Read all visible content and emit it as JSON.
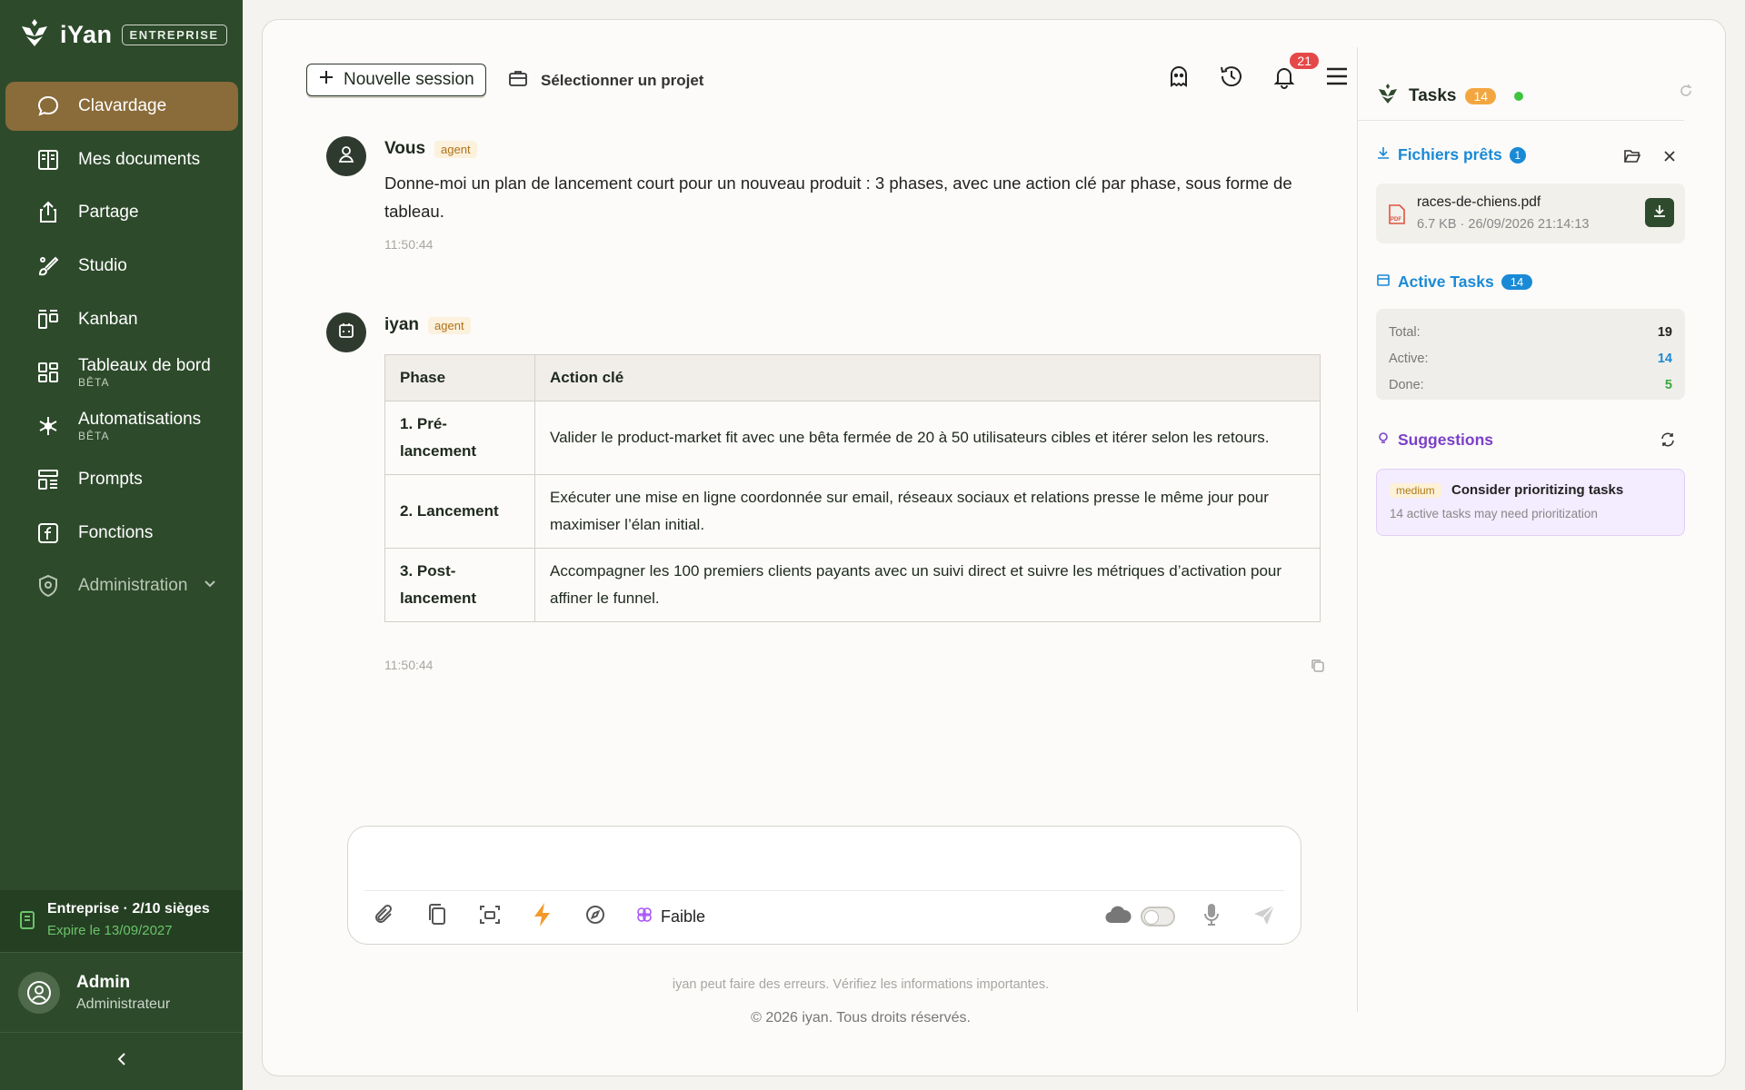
{
  "brand": {
    "name": "iYan",
    "badge": "ENTREPRISE"
  },
  "nav": [
    {
      "label": "Clavardage",
      "icon": "chat-bubble-icon",
      "active": true
    },
    {
      "label": "Mes documents",
      "icon": "book-icon"
    },
    {
      "label": "Partage",
      "icon": "share-icon"
    },
    {
      "label": "Studio",
      "icon": "studio-icon"
    },
    {
      "label": "Kanban",
      "icon": "kanban-icon"
    },
    {
      "label": "Tableaux de bord",
      "sub": "BÊTA",
      "icon": "dashboard-icon"
    },
    {
      "label": "Automatisations",
      "sub": "BÊTA",
      "icon": "automation-icon"
    },
    {
      "label": "Prompts",
      "icon": "prompts-icon"
    },
    {
      "label": "Fonctions",
      "icon": "function-icon"
    },
    {
      "label": "Administration",
      "icon": "shield-icon"
    }
  ],
  "license": {
    "title": "Entreprise · 2/10 sièges",
    "expiry": "Expire le 13/09/2027"
  },
  "user": {
    "name": "Admin",
    "role": "Administrateur"
  },
  "topbar": {
    "new_session": "Nouvelle session",
    "project": "Sélectionner un projet",
    "notifications": "21"
  },
  "messages": {
    "user": {
      "author": "Vous",
      "tag": "agent",
      "text": "Donne-moi un plan de lancement court pour un nouveau produit : 3 phases, avec une action clé par phase, sous forme de tableau.",
      "time": "11:50:44"
    },
    "bot": {
      "author": "iyan",
      "tag": "agent",
      "time": "11:50:44",
      "table": {
        "headers": [
          "Phase",
          "Action clé"
        ],
        "rows": [
          [
            "1. Pré-lancement",
            "Valider le product-market fit avec une bêta fermée de 20 à 50 utilisateurs cibles et itérer selon les retours."
          ],
          [
            "2. Lancement",
            "Exécuter une mise en ligne coordonnée sur email, réseaux sociaux et relations presse le même jour pour maximiser l’élan initial."
          ],
          [
            "3. Post-lancement",
            "Accompagner les 100 premiers clients payants avec un suivi direct et suivre les métriques d’activation pour affiner le funnel."
          ]
        ]
      }
    }
  },
  "composer": {
    "mode": "Faible"
  },
  "disclaimer": "iyan peut faire des erreurs. Vérifiez les informations importantes.",
  "footer": "© 2026 iyan. Tous droits réservés.",
  "panel": {
    "title": "Tasks",
    "count": "14",
    "files": {
      "title": "Fichiers prêts",
      "count": "1",
      "file_name": "races-de-chiens.pdf",
      "file_meta": "6.7 KB · 26/09/2026 21:14:13",
      "pdf_label": "PDF"
    },
    "active": {
      "title": "Active Tasks",
      "count": "14",
      "total_label": "Total:",
      "total": "19",
      "active_label": "Active:",
      "active": "14",
      "done_label": "Done:",
      "done": "5"
    },
    "suggestions": {
      "title": "Suggestions",
      "level": "medium",
      "item_title": "Consider prioritizing tasks",
      "item_sub": "14 active tasks may need prioritization"
    }
  },
  "colors": {
    "sidebar": "#2d4a2b",
    "active_nav": "#8a6b3a",
    "accent_blue": "#1a8ad6",
    "accent_purple": "#7a40c8"
  }
}
